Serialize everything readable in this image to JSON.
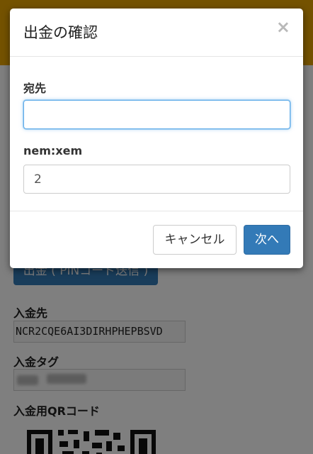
{
  "background": {
    "withdraw_button_label": "出金 ( PINコード送信 )",
    "deposit_address_label": "入金先",
    "deposit_address_value": "NCR2CQE6AI3DIRHPHEPBSVD",
    "deposit_tag_label": "入金タグ",
    "deposit_qr_label": "入金用QRコード"
  },
  "modal": {
    "title": "出金の確認",
    "close_symbol": "×",
    "destination_label": "宛先",
    "destination_value": "",
    "amount_label": "nem:xem",
    "amount_value": "2",
    "cancel_label": "キャンセル",
    "next_label": "次へ"
  },
  "colors": {
    "topbar": "#e8a500",
    "primary": "#337ab7",
    "focus": "#66afe9"
  }
}
